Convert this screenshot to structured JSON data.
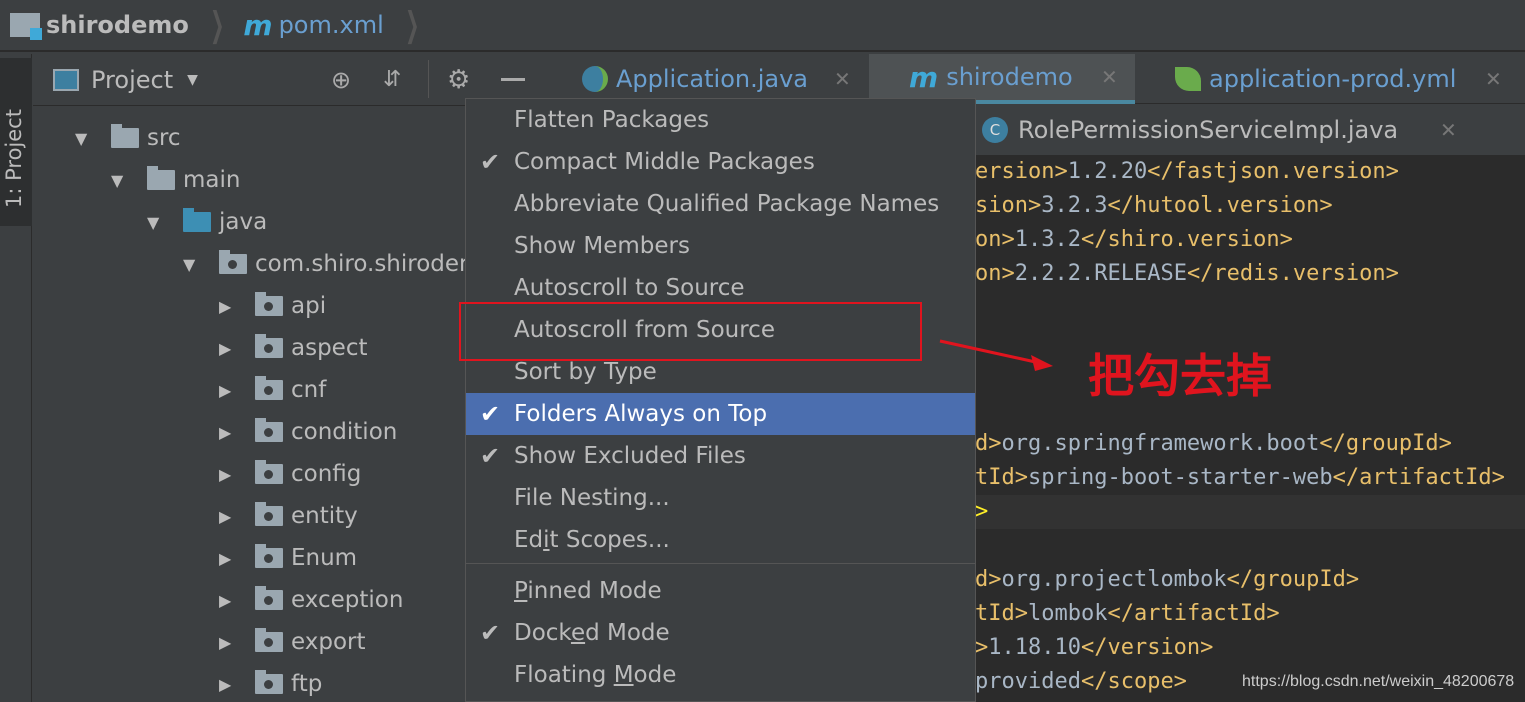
{
  "breadcrumb": {
    "project": "shirodemo",
    "file_icon": "m",
    "file": "pom.xml"
  },
  "tool_window": {
    "side_tab": "1: Project",
    "title": "Project",
    "icons": [
      "locate-icon",
      "collapse-all-icon",
      "gear-icon",
      "hide-icon"
    ]
  },
  "tree": [
    {
      "label": "src",
      "depth": 0,
      "expanded": true,
      "type": "folder"
    },
    {
      "label": "main",
      "depth": 1,
      "expanded": true,
      "type": "folder"
    },
    {
      "label": "java",
      "depth": 2,
      "expanded": true,
      "type": "source-folder"
    },
    {
      "label": "com.shiro.shirodemo",
      "depth": 3,
      "expanded": true,
      "type": "package"
    },
    {
      "label": "api",
      "depth": 4,
      "expanded": false,
      "type": "package"
    },
    {
      "label": "aspect",
      "depth": 4,
      "expanded": false,
      "type": "package"
    },
    {
      "label": "cnf",
      "depth": 4,
      "expanded": false,
      "type": "package"
    },
    {
      "label": "condition",
      "depth": 4,
      "expanded": false,
      "type": "package"
    },
    {
      "label": "config",
      "depth": 4,
      "expanded": false,
      "type": "package"
    },
    {
      "label": "entity",
      "depth": 4,
      "expanded": false,
      "type": "package"
    },
    {
      "label": "Enum",
      "depth": 4,
      "expanded": false,
      "type": "package"
    },
    {
      "label": "exception",
      "depth": 4,
      "expanded": false,
      "type": "package"
    },
    {
      "label": "export",
      "depth": 4,
      "expanded": false,
      "type": "package"
    },
    {
      "label": "ftp",
      "depth": 4,
      "expanded": false,
      "type": "package"
    }
  ],
  "tabs": [
    {
      "label": "Application.java",
      "icon": "spring-boot-class-icon",
      "active": false
    },
    {
      "label": "shirodemo",
      "icon": "m",
      "active": true
    },
    {
      "label": "application-prod.yml",
      "icon": "spring-leaf-icon",
      "active": false
    }
  ],
  "tabs_row2": [
    {
      "label": "RolePermissionServiceImpl.java",
      "icon": "C"
    }
  ],
  "menu": {
    "items": [
      {
        "pre": "Flatten Packages",
        "mn": "",
        "post": "",
        "checked": false
      },
      {
        "pre": "Compact Middle Packages",
        "mn": "",
        "post": "",
        "checked": true
      },
      {
        "pre": "Abbreviate Qualified Package Names",
        "mn": "",
        "post": "",
        "checked": false
      },
      {
        "pre": "Show Members",
        "mn": "",
        "post": "",
        "checked": false
      },
      {
        "pre": "Autoscroll to Source",
        "mn": "",
        "post": "",
        "checked": false
      },
      {
        "pre": "Autoscroll from Source",
        "mn": "",
        "post": "",
        "checked": false
      },
      {
        "pre": "Sort by Type",
        "mn": "",
        "post": "",
        "checked": false
      },
      {
        "pre": "Folders Always on Top",
        "mn": "",
        "post": "",
        "checked": true,
        "selected": true
      },
      {
        "pre": "Show Excluded Files",
        "mn": "",
        "post": "",
        "checked": true
      },
      {
        "pre": "File Nesting...",
        "mn": "",
        "post": "",
        "checked": false
      },
      {
        "pre": "Ed",
        "mn": "i",
        "post": "t Scopes...",
        "checked": false
      }
    ],
    "modes": [
      {
        "pre": "",
        "mn": "P",
        "post": "inned Mode",
        "checked": false
      },
      {
        "pre": "Dock",
        "mn": "e",
        "post": "d Mode",
        "checked": true
      },
      {
        "pre": "Floating ",
        "mn": "M",
        "post": "ode",
        "checked": false
      }
    ]
  },
  "code": [
    {
      "line": [
        [
          "t",
          "ersion>"
        ],
        [
          "v",
          "1.2.20"
        ],
        [
          "t",
          "</fastjson.version>"
        ]
      ]
    },
    {
      "line": [
        [
          "t",
          "sion>"
        ],
        [
          "v",
          "3.2.3"
        ],
        [
          "t",
          "</hutool.version>"
        ]
      ]
    },
    {
      "line": [
        [
          "t",
          "on>"
        ],
        [
          "v",
          "1.3.2"
        ],
        [
          "t",
          "</shiro.version>"
        ]
      ]
    },
    {
      "line": [
        [
          "t",
          "on>"
        ],
        [
          "v",
          "2.2.2.RELEASE"
        ],
        [
          "t",
          "</redis.version>"
        ]
      ]
    },
    {
      "line": [
        [
          "t",
          "d>"
        ],
        [
          "v",
          "org.springframework.boot"
        ],
        [
          "t",
          "</groupId>"
        ]
      ]
    },
    {
      "line": [
        [
          "t",
          "tId>"
        ],
        [
          "v",
          "spring-boot-starter-web"
        ],
        [
          "t",
          "</artifactId>"
        ]
      ]
    },
    {
      "line": [
        [
          "t",
          ">"
        ]
      ]
    },
    {
      "line": [
        [
          "t",
          "d>"
        ],
        [
          "v",
          "org.projectlombok"
        ],
        [
          "t",
          "</groupId>"
        ]
      ]
    },
    {
      "line": [
        [
          "t",
          "tId>"
        ],
        [
          "v",
          "lombok"
        ],
        [
          "t",
          "</artifactId>"
        ]
      ]
    },
    {
      "line": [
        [
          "t",
          ">"
        ],
        [
          "v",
          "1.18.10"
        ],
        [
          "t",
          "</version>"
        ]
      ]
    },
    {
      "line": [
        [
          "v",
          "provided"
        ],
        [
          "t",
          "</scope>"
        ]
      ]
    }
  ],
  "annotation": {
    "text": "把勾去掉",
    "color": "#e0141e",
    "target": "Autoscroll from Source"
  },
  "watermark": "https://blog.csdn.net/weixin_48200678",
  "colors": {
    "selection": "#4b6eaf",
    "background": "#3c3f41",
    "editor": "#2b2b2b",
    "tag": "#e8bf6a",
    "text": "#a9b7c6",
    "maven": "#3fa9d8"
  }
}
